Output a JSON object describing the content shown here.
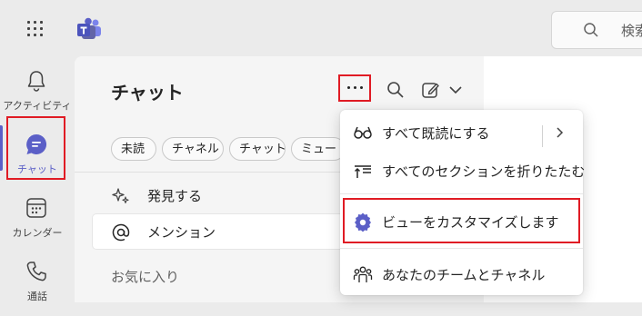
{
  "topbar": {
    "apps_icon": "waffle-icon",
    "logo_icon": "teams-logo-icon",
    "search_placeholder": "検索"
  },
  "rail": {
    "items": [
      {
        "label": "アクティビティ",
        "icon": "bell-icon"
      },
      {
        "label": "チャット",
        "icon": "chat-icon",
        "active": true
      },
      {
        "label": "カレンダー",
        "icon": "calendar-icon"
      },
      {
        "label": "通話",
        "icon": "phone-icon"
      }
    ]
  },
  "chat": {
    "title": "チャット",
    "filters": [
      "未読",
      "チャネル",
      "チャット",
      "ミュート"
    ],
    "list": [
      {
        "label": "発見する",
        "icon": "sparkle-icon"
      },
      {
        "label": "メンション",
        "icon": "at-icon"
      }
    ],
    "section": "お気に入り"
  },
  "menu": {
    "items": [
      {
        "label": "すべて既読にする",
        "icon": "glasses-icon"
      },
      {
        "label": "すべてのセクションを折りたたむ",
        "icon": "collapse-icon"
      },
      {
        "label": "ビューをカスタマイズします",
        "icon": "settings-icon"
      },
      {
        "label": "あなたのチームとチャネル",
        "icon": "people-team-icon"
      }
    ]
  },
  "colors": {
    "accent": "#5b5fc7",
    "highlight": "#e01b24"
  }
}
